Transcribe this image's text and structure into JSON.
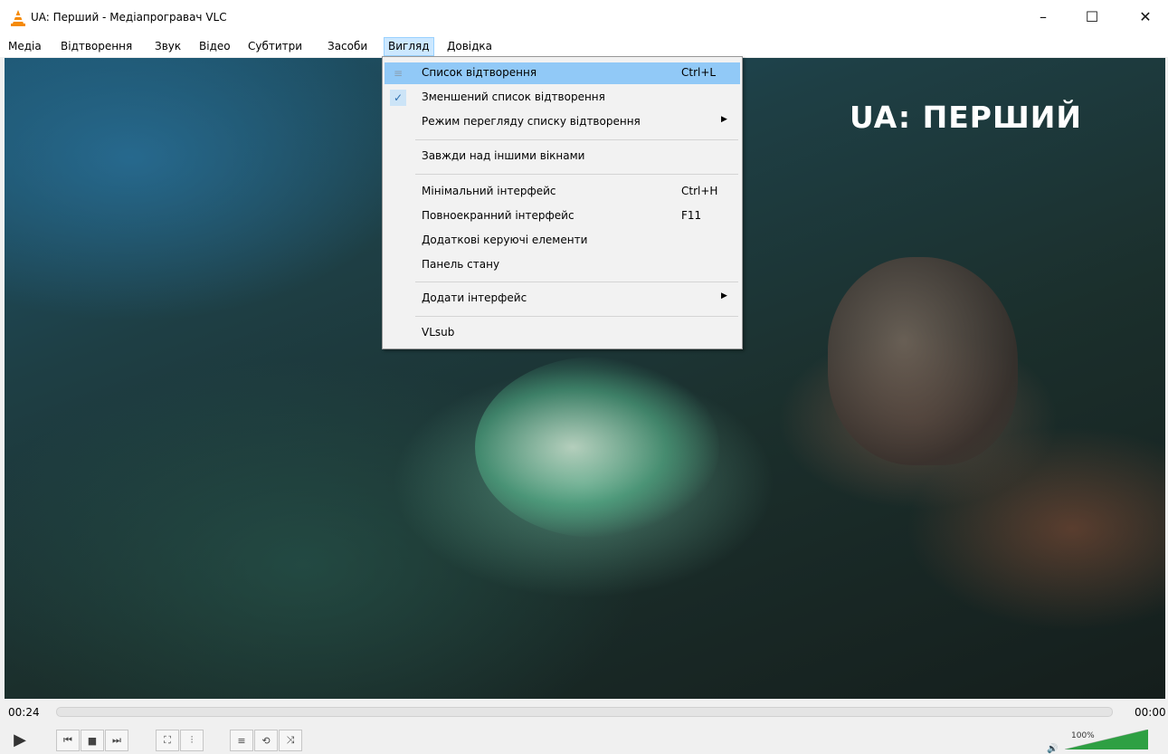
{
  "window": {
    "title": "UA: Перший - Медіапрогравач VLC",
    "min_icon": "minimize-icon",
    "max_icon": "maximize-icon",
    "close_icon": "close-icon",
    "min_glyph": "–",
    "max_glyph": "☐",
    "close_glyph": "✕"
  },
  "menubar": {
    "items": [
      "Медіа",
      "Відтворення",
      "Звук",
      "Відео",
      "Субтитри",
      "Засоби",
      "Вигляд",
      "Довідка"
    ],
    "active": "Вигляд"
  },
  "video": {
    "channel_logo": "UA: ПЕРШИЙ"
  },
  "view_menu": {
    "items": [
      {
        "label": "Список відтворення",
        "shortcut": "Ctrl+L",
        "icon": "playlist-icon",
        "highlighted": true
      },
      {
        "label": "Зменшений список відтворення",
        "checked": true
      },
      {
        "label": "Режим перегляду списку відтворення",
        "submenu": true
      },
      {
        "label": "Завжди над іншими вікнами"
      },
      {
        "label": "Мінімальний інтерфейс",
        "shortcut": "Ctrl+H"
      },
      {
        "label": "Повноекранний інтерфейс",
        "shortcut": "F11"
      },
      {
        "label": "Додаткові керуючі елементи"
      },
      {
        "label": "Панель стану"
      },
      {
        "label": "Додати інтерфейс",
        "submenu": true
      },
      {
        "label": "VLsub"
      }
    ],
    "check_glyph": "✓",
    "arrow_glyph": "▶",
    "playlist_glyph": "≡"
  },
  "controls": {
    "current_time": "00:24",
    "total_time": "00:00",
    "volume": "100%",
    "volume_level": 1.0,
    "buttons": [
      {
        "name": "play-icon",
        "glyph": "▶"
      },
      {
        "name": "previous-icon",
        "glyph": "⏮"
      },
      {
        "name": "stop-icon",
        "glyph": "■"
      },
      {
        "name": "next-icon",
        "glyph": "⏭"
      },
      {
        "name": "fullscreen-icon",
        "glyph": "⛶"
      },
      {
        "name": "extended-settings-icon",
        "glyph": "⫶"
      },
      {
        "name": "playlist-icon",
        "glyph": "≡"
      },
      {
        "name": "loop-icon",
        "glyph": "⟲"
      },
      {
        "name": "shuffle-icon",
        "glyph": "⤨"
      }
    ],
    "volume_glyph": "🔊",
    "accent_color": "#2ea043"
  }
}
